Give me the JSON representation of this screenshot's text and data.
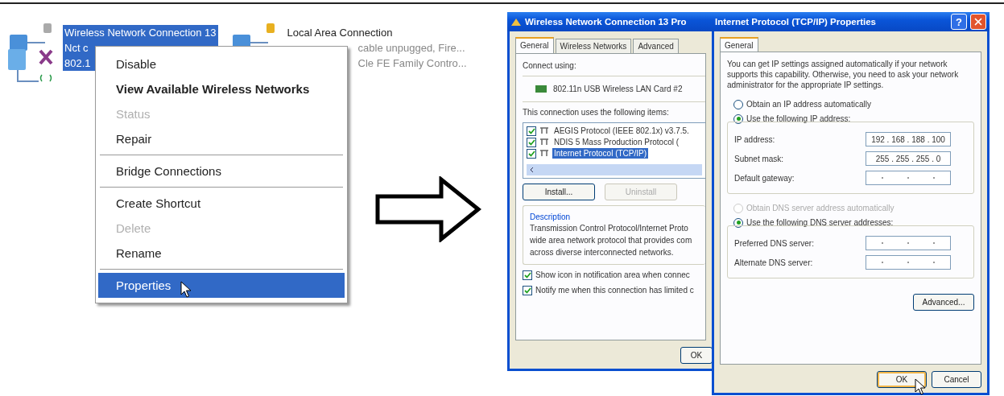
{
  "connections": [
    {
      "name": "Wireless Network Connection 13",
      "status": "Nct c",
      "device": "802.1",
      "kind": "wireless",
      "selected": true
    },
    {
      "name": "Local Area Connection",
      "status": "cable unpugged, Fire...",
      "device": "Cle FE Family Contro...",
      "kind": "lan",
      "selected": false
    }
  ],
  "context_menu": {
    "items": [
      {
        "kind": "item",
        "label": "Disable",
        "bold": false,
        "disabled": false,
        "selected": false
      },
      {
        "kind": "item",
        "label": "View Available Wireless Networks",
        "bold": true,
        "disabled": false,
        "selected": false
      },
      {
        "kind": "item",
        "label": "Status",
        "bold": false,
        "disabled": true,
        "selected": false
      },
      {
        "kind": "item",
        "label": "Repair",
        "bold": false,
        "disabled": false,
        "selected": false
      },
      {
        "kind": "separator"
      },
      {
        "kind": "item",
        "label": "Bridge Connections",
        "bold": false,
        "disabled": false,
        "selected": false
      },
      {
        "kind": "separator"
      },
      {
        "kind": "item",
        "label": "Create Shortcut",
        "bold": false,
        "disabled": false,
        "selected": false
      },
      {
        "kind": "item",
        "label": "Delete",
        "bold": false,
        "disabled": true,
        "selected": false
      },
      {
        "kind": "item",
        "label": "Rename",
        "bold": false,
        "disabled": false,
        "selected": false
      },
      {
        "kind": "separator"
      },
      {
        "kind": "item",
        "label": "Properties",
        "bold": false,
        "disabled": false,
        "selected": true
      }
    ]
  },
  "connection_dialog": {
    "title": "Wireless Network Connection 13 Pro",
    "tabs": [
      {
        "label": "General",
        "selected": true
      },
      {
        "label": "Wireless Networks",
        "selected": false
      },
      {
        "label": "Advanced",
        "selected": false
      }
    ],
    "connect_using_label": "Connect using:",
    "adapter": "802.11n USB Wireless LAN Card #2",
    "items_label": "This connection uses the following items:",
    "items": [
      {
        "label": "AEGIS Protocol (IEEE 802.1x) v3.7.5.",
        "checked": true,
        "selected": false
      },
      {
        "label": "NDIS 5 Mass Production Protocol (",
        "checked": true,
        "selected": false
      },
      {
        "label": "Internet Protocol (TCP/IP)",
        "checked": true,
        "selected": true
      }
    ],
    "buttons": [
      {
        "label": "Install...",
        "disabled": false
      },
      {
        "label": "Uninstall",
        "disabled": true
      }
    ],
    "description_title": "Description",
    "description_lines": [
      "Transmission Control Protocol/Internet Proto",
      "wide area network protocol that provides com",
      "across diverse interconnected networks."
    ],
    "options": [
      {
        "label": "Show icon in notification area when connec",
        "checked": true
      },
      {
        "label": "Notify me when this connection has limited c",
        "checked": true
      }
    ],
    "ok_button": "OK"
  },
  "tcpip_dialog": {
    "title": "Internet Protocol (TCP/IP) Properties",
    "help_button": "?",
    "tabs": [
      {
        "label": "General",
        "selected": true
      }
    ],
    "intro": "You can get IP settings assigned automatically if your network supports this capability. Otherwise, you need to ask your network administrator for the appropriate IP settings.",
    "ip_modes": [
      {
        "label": "Obtain an IP address automatically",
        "selected": false,
        "disabled": false
      },
      {
        "label": "Use the following IP address:",
        "selected": true,
        "disabled": false
      }
    ],
    "ip_fields": [
      {
        "label": "IP address:",
        "value": "192 . 168 . 188 . 100"
      },
      {
        "label": "Subnet mask:",
        "value": "255 . 255 . 255 . 0"
      },
      {
        "label": "Default gateway:"
      }
    ],
    "dns_modes": [
      {
        "label": "Obtain DNS server address automatically",
        "selected": false,
        "disabled": true
      },
      {
        "label": "Use the following DNS server addresses:",
        "selected": true,
        "disabled": false
      }
    ],
    "dns_fields": [
      {
        "label": "Preferred DNS server:"
      },
      {
        "label": "Alternate DNS server:"
      }
    ],
    "advanced_button": "Advanced...",
    "buttons": [
      {
        "label": "OK",
        "focused": true
      },
      {
        "label": "Cancel",
        "focused": false
      }
    ]
  }
}
